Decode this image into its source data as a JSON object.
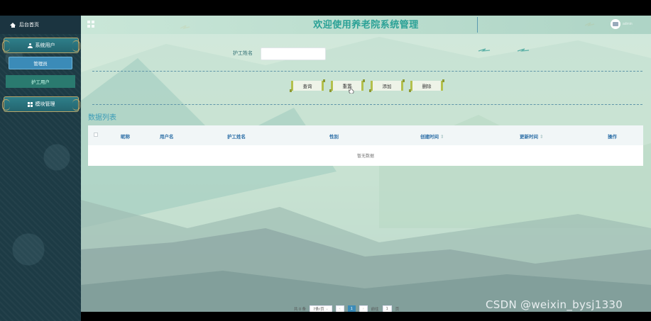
{
  "sidebar": {
    "home_label": "后台首页",
    "menus": [
      {
        "label": "系统用户",
        "items": [
          {
            "label": "管理员",
            "active": true
          },
          {
            "label": "护工用户",
            "active": false
          }
        ]
      },
      {
        "label": "模块管理",
        "items": []
      }
    ]
  },
  "header": {
    "title": "欢迎使用养老院系统管理",
    "user_name": "admin"
  },
  "search": {
    "label": "护工姓名",
    "value": "",
    "placeholder": ""
  },
  "buttons": {
    "query": "查询",
    "reset": "重置",
    "add": "添加",
    "delete": "删除"
  },
  "list": {
    "title": "数据列表",
    "columns": [
      "昵称",
      "用户名",
      "护工姓名",
      "性别",
      "创建时间",
      "更新时间",
      "操作"
    ],
    "sortable": [
      "创建时间",
      "更新时间"
    ],
    "sort_icon": "⇕",
    "empty_text": "暂无数据"
  },
  "pagination": {
    "total_text": "共 0 条",
    "page_size": "7条/页",
    "current_page": "1",
    "goto_label": "前往",
    "goto_value": "1",
    "page_unit": "页"
  },
  "watermark": "CSDN @weixin_bysj1330",
  "colors": {
    "accent": "#2aa196",
    "active_menu": "#3b8bb8",
    "sidebar_bg": "#1d3b45",
    "column_header": "#2d6fa7"
  }
}
